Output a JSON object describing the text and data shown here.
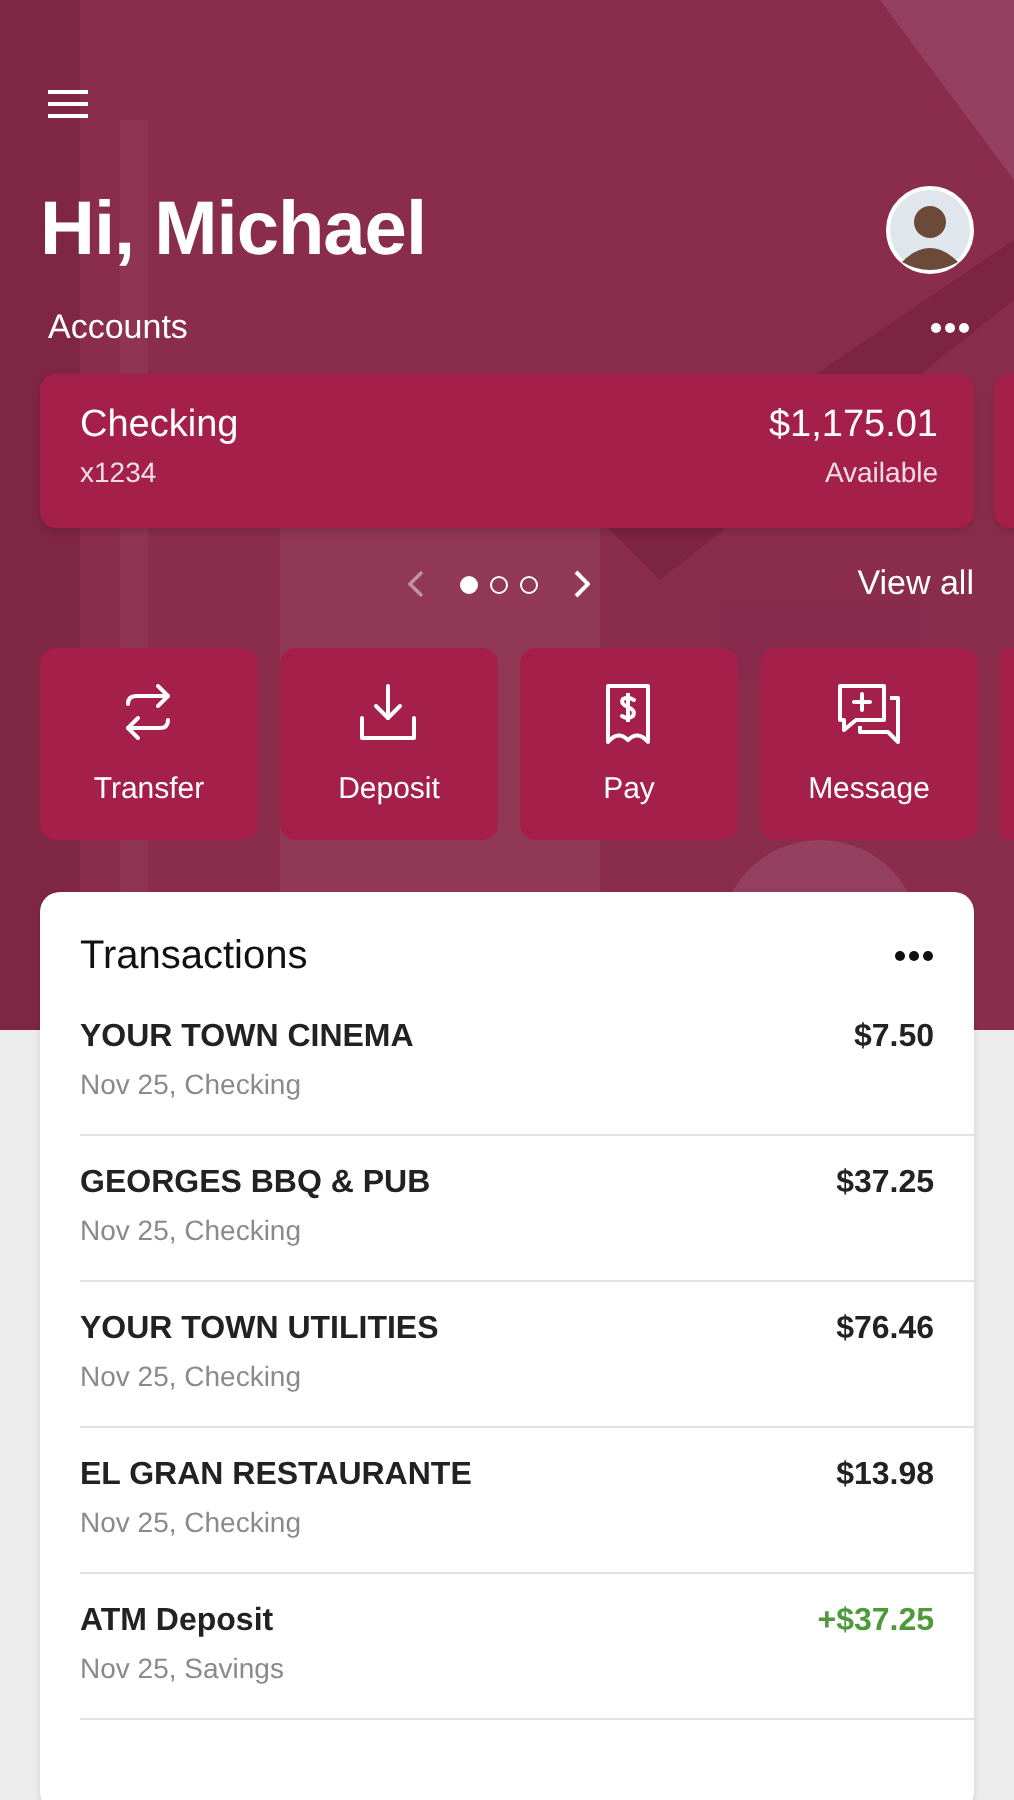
{
  "greeting": "Hi, Michael",
  "accounts": {
    "title": "Accounts",
    "items": [
      {
        "name": "Checking",
        "number": "x1234",
        "balance": "$1,175.01",
        "balance_label": "Available"
      }
    ],
    "pages": [
      {
        "selected": true
      },
      {
        "selected": false
      },
      {
        "selected": false
      }
    ],
    "view_all": "View all"
  },
  "actions": [
    {
      "kind": "transfer",
      "label": "Transfer"
    },
    {
      "kind": "deposit",
      "label": "Deposit"
    },
    {
      "kind": "pay",
      "label": "Pay"
    },
    {
      "kind": "message",
      "label": "Message"
    }
  ],
  "transactions": {
    "title": "Transactions",
    "rows": [
      {
        "name": "YOUR TOWN CINEMA",
        "detail": "Nov 25, Checking",
        "amount": "$7.50",
        "kind": "debit"
      },
      {
        "name": "GEORGES BBQ & PUB",
        "detail": "Nov 25, Checking",
        "amount": "$37.25",
        "kind": "debit"
      },
      {
        "name": "YOUR TOWN UTILITIES",
        "detail": "Nov 25, Checking",
        "amount": "$76.46",
        "kind": "debit"
      },
      {
        "name": "EL GRAN RESTAURANTE",
        "detail": "Nov 25, Checking",
        "amount": "$13.98",
        "kind": "debit"
      },
      {
        "name": "ATM Deposit",
        "detail": "Nov 25, Savings",
        "amount": "+$37.25",
        "kind": "credit"
      }
    ]
  }
}
